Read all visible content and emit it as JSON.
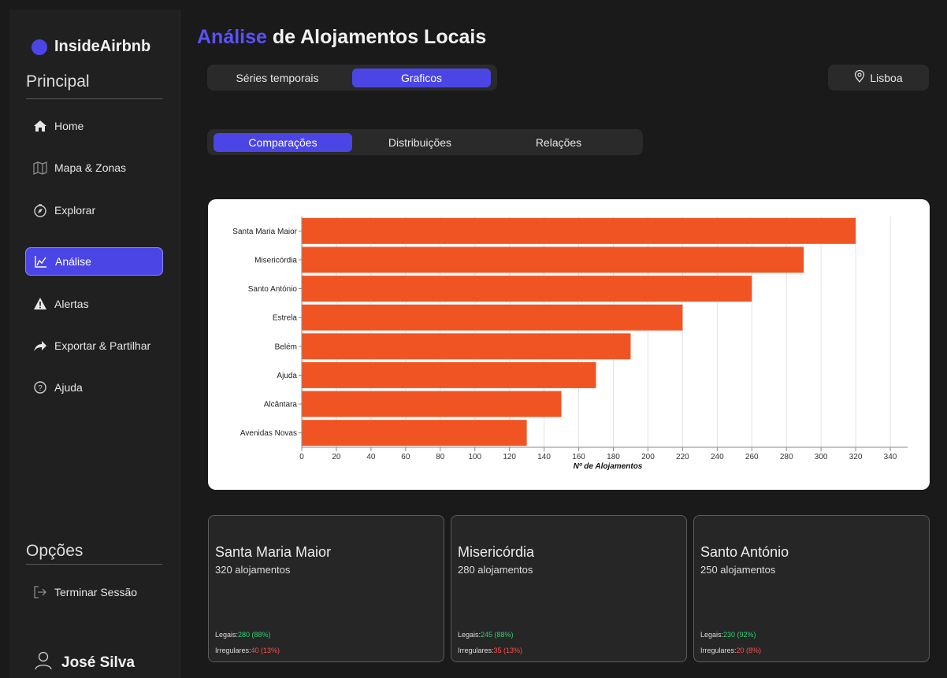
{
  "brand": {
    "name": "InsideAirbnb"
  },
  "sidebar": {
    "principal_title": "Principal",
    "items": [
      {
        "label": "Home",
        "icon": "home-icon"
      },
      {
        "label": "Mapa & Zonas",
        "icon": "map-icon"
      },
      {
        "label": "Explorar",
        "icon": "compass-icon"
      },
      {
        "label": "Análise",
        "icon": "chart-line-icon",
        "active": true
      },
      {
        "label": "Alertas",
        "icon": "warning-icon"
      },
      {
        "label": "Exportar & Partilhar",
        "icon": "share-icon"
      },
      {
        "label": "Ajuda",
        "icon": "help-icon"
      }
    ],
    "options_title": "Opções",
    "logout_label": "Terminar Sessão",
    "user_name": "José Silva"
  },
  "header": {
    "title_accent": "Análise",
    "title_rest": " de Alojamentos Locais",
    "tabs": [
      {
        "label": "Séries temporais",
        "active": false
      },
      {
        "label": "Graficos",
        "active": true
      }
    ],
    "location": "Lisboa"
  },
  "subtabs": [
    {
      "label": "Comparações",
      "active": true
    },
    {
      "label": "Distribuições",
      "active": false
    },
    {
      "label": "Relações",
      "active": false
    }
  ],
  "chart_data": {
    "type": "bar",
    "orientation": "horizontal",
    "categories": [
      "Santa Maria Maior",
      "Misericórdia",
      "Santo António",
      "Estrela",
      "Belém",
      "Ajuda",
      "Alcântara",
      "Avenidas Novas"
    ],
    "values": [
      320,
      290,
      260,
      220,
      190,
      170,
      150,
      130
    ],
    "xlabel": "Nº de Alojamentos",
    "xlim": [
      0,
      350
    ],
    "xticks": [
      0,
      20,
      40,
      60,
      80,
      100,
      120,
      140,
      160,
      180,
      200,
      220,
      240,
      260,
      280,
      300,
      320,
      340
    ],
    "grid": true,
    "bar_color": "#f05423"
  },
  "cards": [
    {
      "name": "Santa Maria Maior",
      "count": "320 alojamentos",
      "legal_label": "Legais:",
      "legal_value": "280 (88%)",
      "irregular_label": "Irregulares:",
      "irregular_value": "40 (13%)"
    },
    {
      "name": "Misericórdia",
      "count": "280 alojamentos",
      "legal_label": "Legais:",
      "legal_value": "245 (88%)",
      "irregular_label": "Irregulares:",
      "irregular_value": "35 (13%)"
    },
    {
      "name": "Santo António",
      "count": "250 alojamentos",
      "legal_label": "Legais:",
      "legal_value": "230 (92%)",
      "irregular_label": "Irregulares:",
      "irregular_value": "20 (8%)"
    }
  ],
  "colors": {
    "accent": "#4b45e6",
    "legal": "#2fcf78",
    "irregular": "#ff4e4e"
  }
}
